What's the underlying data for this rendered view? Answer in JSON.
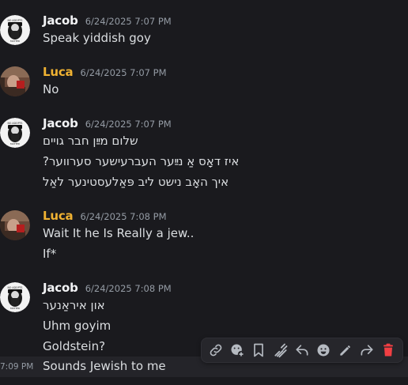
{
  "colors": {
    "background": "#1a1a1e",
    "author_default": "#f2f3f5",
    "author_luca": "#f0b232",
    "timestamp": "#949ba4",
    "text": "#dbdee1",
    "delete": "#f23f43"
  },
  "messages": [
    {
      "author": "Jacob",
      "timestamp": "6/24/2025 7:07 PM",
      "lines": [
        "Speak yiddish goy"
      ]
    },
    {
      "author": "Luca",
      "timestamp": "6/24/2025 7:07 PM",
      "lines": [
        "No"
      ]
    },
    {
      "author": "Jacob",
      "timestamp": "6/24/2025 7:07 PM",
      "lines": [
        "שלום מײַן חבר גויים",
        "איז דאָס אַ נײַער העברעישער סערווער?",
        "איך האָב נישט ליב פּאַלעסטינער לאַל"
      ]
    },
    {
      "author": "Luca",
      "timestamp": "6/24/2025 7:08 PM",
      "lines": [
        "Wait It he Is Really a jew..",
        "If*"
      ]
    },
    {
      "author": "Jacob",
      "timestamp": "6/24/2025 7:08 PM",
      "lines": [
        "און איראַנער",
        "Uhm goyim",
        "Goldstein?"
      ]
    }
  ],
  "hovered_message": {
    "time": "7:09 PM",
    "text": "Sounds Jewish to me"
  },
  "avatar_badge_top": "NO ADOPTS",
  "avatar_badge_bottom": "MATTER",
  "toolbar": {
    "icons": [
      "link-icon",
      "add-reaction-icon",
      "bookmark-icon",
      "super-reaction-icon",
      "reply-icon",
      "emoji-icon",
      "edit-icon",
      "forward-icon",
      "delete-icon"
    ]
  }
}
